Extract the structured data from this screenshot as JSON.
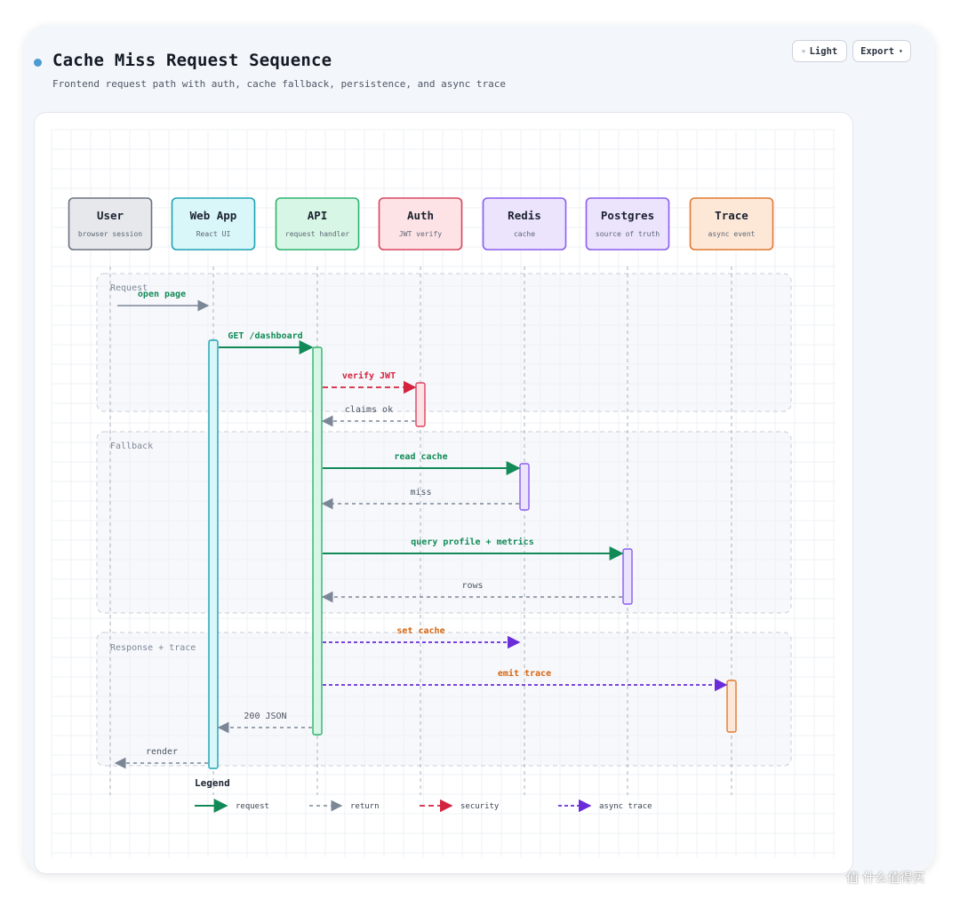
{
  "header": {
    "title": "Cache Miss Request Sequence",
    "subtitle": "Frontend request path with auth, cache fallback, persistence, and async trace",
    "light_label": "Light",
    "export_label": "Export"
  },
  "participants": [
    {
      "name": "User",
      "desc": "browser session",
      "fill": "#e6e8ec",
      "stroke": "#6b7280"
    },
    {
      "name": "Web App",
      "desc": "React UI",
      "fill": "#d9f6f9",
      "stroke": "#1aa3b5"
    },
    {
      "name": "API",
      "desc": "request handler",
      "fill": "#d8f6e6",
      "stroke": "#2cb36b"
    },
    {
      "name": "Auth",
      "desc": "JWT verify",
      "fill": "#fde2e6",
      "stroke": "#d9455f"
    },
    {
      "name": "Redis",
      "desc": "cache",
      "fill": "#ece3fd",
      "stroke": "#8a5cf0"
    },
    {
      "name": "Postgres",
      "desc": "source of truth",
      "fill": "#ece3fd",
      "stroke": "#8a5cf0"
    },
    {
      "name": "Trace",
      "desc": "async event",
      "fill": "#fde8d8",
      "stroke": "#e07a2f"
    }
  ],
  "groups": [
    {
      "label": "Request"
    },
    {
      "label": "Fallback"
    },
    {
      "label": "Response + trace"
    }
  ],
  "messages": [
    {
      "label": "open page",
      "from": 0,
      "to": 1,
      "kind": "request"
    },
    {
      "label": "GET /dashboard",
      "from": 1,
      "to": 2,
      "kind": "request"
    },
    {
      "label": "verify JWT",
      "from": 2,
      "to": 3,
      "kind": "security"
    },
    {
      "label": "claims ok",
      "from": 3,
      "to": 2,
      "kind": "return"
    },
    {
      "label": "read cache",
      "from": 2,
      "to": 4,
      "kind": "request"
    },
    {
      "label": "miss",
      "from": 4,
      "to": 2,
      "kind": "return"
    },
    {
      "label": "query profile + metrics",
      "from": 2,
      "to": 5,
      "kind": "request"
    },
    {
      "label": "rows",
      "from": 5,
      "to": 2,
      "kind": "return"
    },
    {
      "label": "set cache",
      "from": 2,
      "to": 4,
      "kind": "async"
    },
    {
      "label": "emit trace",
      "from": 2,
      "to": 6,
      "kind": "async"
    },
    {
      "label": "200 JSON",
      "from": 2,
      "to": 1,
      "kind": "return"
    },
    {
      "label": "render",
      "from": 1,
      "to": 0,
      "kind": "return"
    }
  ],
  "legend": {
    "title": "Legend",
    "items": [
      {
        "label": "request",
        "kind": "request"
      },
      {
        "label": "return",
        "kind": "return"
      },
      {
        "label": "security",
        "kind": "security"
      },
      {
        "label": "async trace",
        "kind": "async"
      }
    ]
  },
  "colors": {
    "request": "#118a57",
    "return": "#7b8797",
    "security": "#d4233f",
    "async": "#6a2bd9",
    "async_label": "#d8650f",
    "group_border": "#c8ced8",
    "group_label": "#7b8797",
    "grid": "#eef0f4",
    "lifeline": "#a9b0bb"
  },
  "watermark": "值 什么值得买"
}
